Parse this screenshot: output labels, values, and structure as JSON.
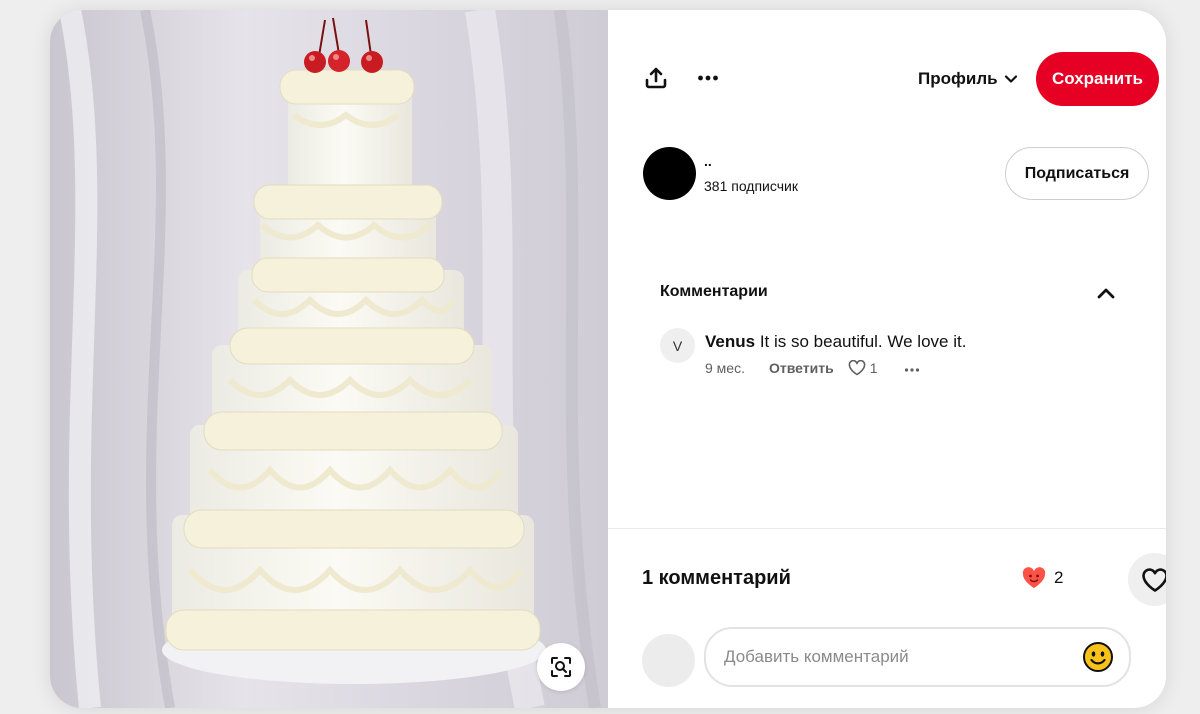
{
  "toolbar": {
    "share_icon": "share-upload-icon",
    "more_icon": "ellipsis-icon",
    "profile_label": "Профиль",
    "save_label": "Сохранить",
    "accent": "#e60023"
  },
  "creator": {
    "name": "..",
    "followers": "381 подписчик",
    "follow_label": "Подписаться"
  },
  "comments": {
    "title": "Комментарии",
    "items": [
      {
        "avatar_letter": "V",
        "author": "Venus",
        "text": " It is so beautiful. We love it.",
        "time": "9 мес.",
        "reply_label": "Ответить",
        "likes": "1"
      }
    ]
  },
  "footer": {
    "count_label": "1 комментарий",
    "reactions": "2",
    "composer_placeholder": "Добавить комментарий"
  }
}
